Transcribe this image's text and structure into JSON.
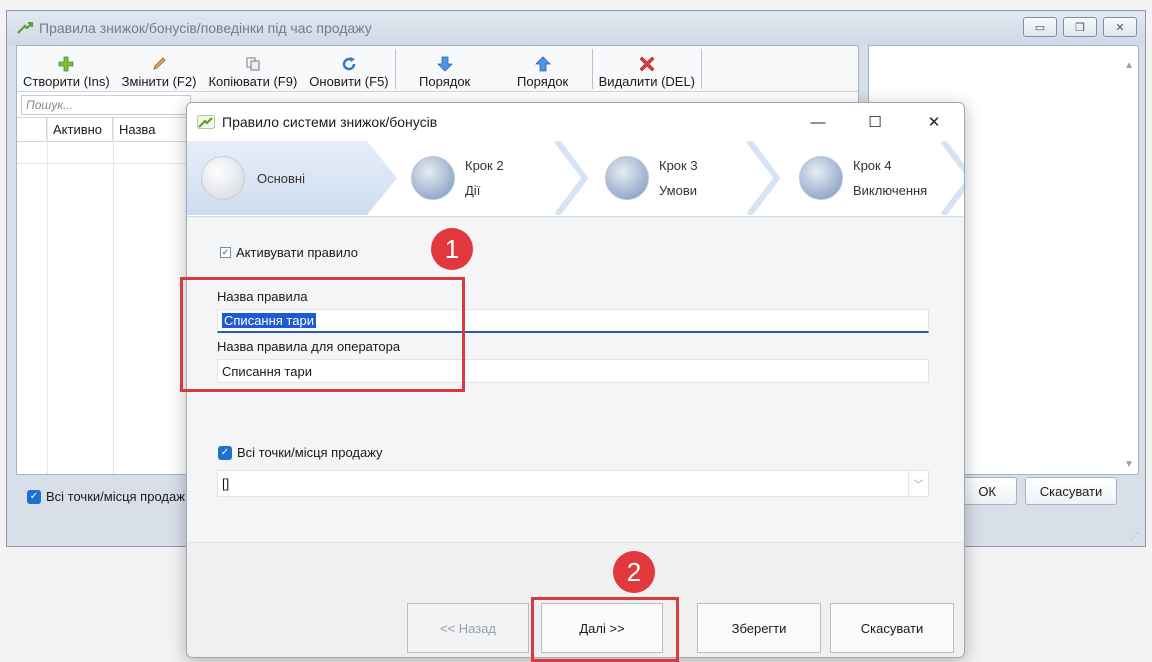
{
  "background_window": {
    "title": "Правила знижок/бонусів/поведінки під час продажу",
    "title_buttons": [
      "▭",
      "❐",
      "✕"
    ],
    "toolbar": [
      {
        "label": "Створити (Ins)",
        "icon": "plus-icon"
      },
      {
        "label": "Змінити (F2)",
        "icon": "pencil-icon"
      },
      {
        "label": "Копіювати (F9)",
        "icon": "copy-icon"
      },
      {
        "label": "Оновити (F5)",
        "icon": "refresh-icon"
      },
      {
        "label": "Порядок",
        "icon": "arrow-down-icon"
      },
      {
        "label": "Порядок",
        "icon": "arrow-up-icon"
      },
      {
        "label": "Видалити (DEL)",
        "icon": "delete-icon"
      }
    ],
    "search_placeholder": "Пошук...",
    "columns": [
      "Активно",
      "Назва"
    ],
    "all_points_checkbox": "Всі точки/місця продаж",
    "ok_button": "ОК",
    "cancel_button": "Скасувати"
  },
  "dialog": {
    "title": "Правило системи знижок/бонусів",
    "controls": {
      "minimize": "—",
      "maximize": "☐",
      "close": "✕"
    },
    "steps": [
      {
        "line1": "Основні",
        "line2": "",
        "active": true
      },
      {
        "line1": "Крок 2",
        "line2": "Дії",
        "active": false
      },
      {
        "line1": "Крок 3",
        "line2": "Умови",
        "active": false
      },
      {
        "line1": "Крок 4",
        "line2": "Виключення",
        "active": false
      }
    ],
    "activate_rule_label": "Активувати правило",
    "activate_rule_checked": true,
    "rule_name_label": "Назва правила",
    "rule_name_value": "Списання тари",
    "operator_name_label": "Назва правила для оператора",
    "operator_name_value": "Списання тари",
    "all_points_label": "Всі точки/місця продажу",
    "all_points_checked": true,
    "points_select_value": "[]",
    "buttons": {
      "back": "<< Назад",
      "next": "Далі >>",
      "save": "Зберегти",
      "cancel": "Скасувати"
    }
  },
  "annotations": [
    {
      "number": "1"
    },
    {
      "number": "2"
    }
  ],
  "colors": {
    "annotation": "#e0383d",
    "accent": "#1f5ad0"
  }
}
